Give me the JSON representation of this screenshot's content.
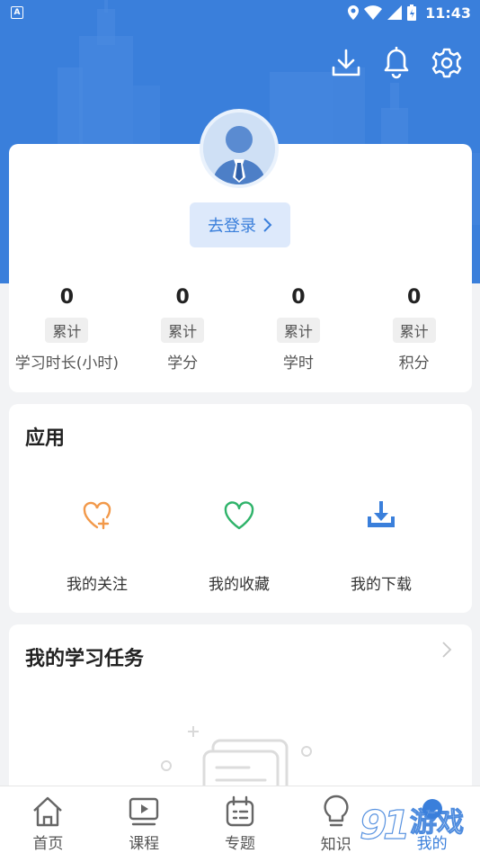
{
  "status_bar": {
    "time": "11:43",
    "notification_icon": "a-icon"
  },
  "header_actions": [
    "download-icon",
    "bell-icon",
    "gear-icon"
  ],
  "colors": {
    "primary": "#3a7fdb",
    "follow": "#f2994a",
    "favorite": "#2fb36a",
    "download": "#3a7fdb"
  },
  "profile": {
    "login_label": "去登录"
  },
  "stats": [
    {
      "value": "0",
      "tag": "累计",
      "label": "学习时长(小时)"
    },
    {
      "value": "0",
      "tag": "累计",
      "label": "学分"
    },
    {
      "value": "0",
      "tag": "累计",
      "label": "学时"
    },
    {
      "value": "0",
      "tag": "累计",
      "label": "积分"
    }
  ],
  "apps": {
    "title": "应用",
    "items": [
      {
        "label": "我的关注",
        "icon": "heart-plus-icon"
      },
      {
        "label": "我的收藏",
        "icon": "heart-icon"
      },
      {
        "label": "我的下载",
        "icon": "download-icon"
      }
    ]
  },
  "tasks": {
    "title": "我的学习任务"
  },
  "nav": [
    {
      "label": "首页",
      "icon": "home-icon"
    },
    {
      "label": "课程",
      "icon": "play-icon"
    },
    {
      "label": "专题",
      "icon": "topic-icon"
    },
    {
      "label": "知识",
      "icon": "bulb-icon"
    },
    {
      "label": "我的",
      "icon": "user-icon",
      "active": true
    }
  ],
  "watermark": {
    "text": "游戏"
  }
}
